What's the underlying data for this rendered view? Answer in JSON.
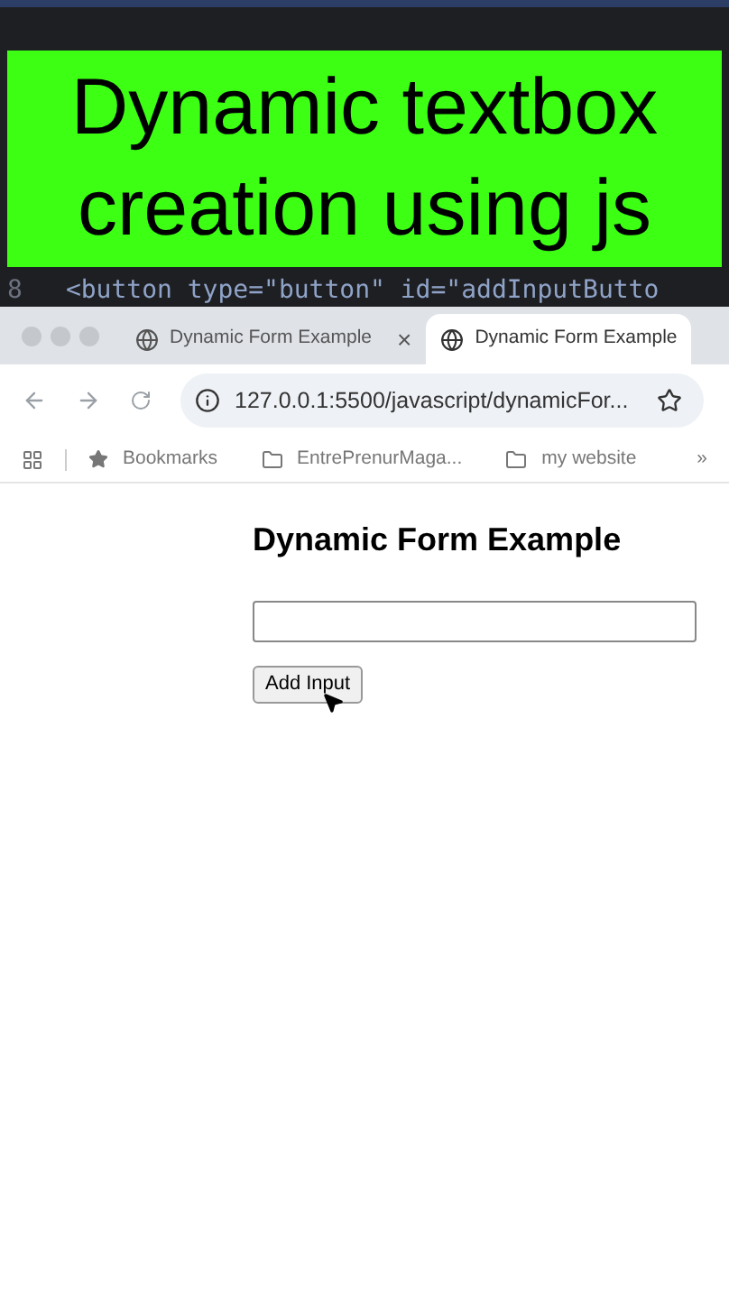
{
  "overlay_title": {
    "lines": [
      "Dynamic textbox",
      "creation using js"
    ]
  },
  "editor": {
    "line_number": "8",
    "code_line": "<button type=\"button\" id=\"addInputButto"
  },
  "browser": {
    "tabs": [
      {
        "title": "Dynamic Form Example",
        "selected": false,
        "close": "×"
      },
      {
        "title": "Dynamic Form Example",
        "selected": true
      }
    ],
    "address": "127.0.0.1:5500/javascript/dynamicFor...",
    "bookmarks": [
      {
        "kind": "star",
        "label": "Bookmarks"
      },
      {
        "kind": "folder",
        "label": "EntrePrenurMaga..."
      },
      {
        "kind": "folder",
        "label": "my website"
      }
    ],
    "more": "»"
  },
  "page": {
    "heading": "Dynamic Form Example",
    "button": "Add Input"
  }
}
